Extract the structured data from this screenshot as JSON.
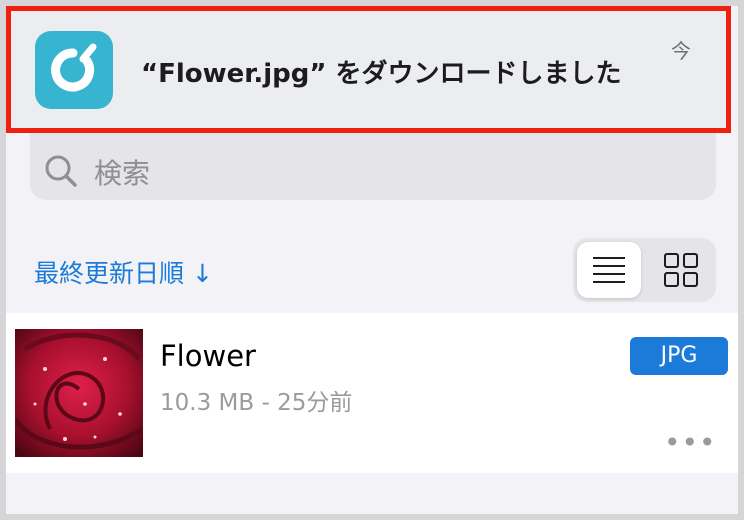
{
  "notification": {
    "message": "“Flower.jpg” をダウンロードしました",
    "time": "今",
    "app_icon": "download-app-icon",
    "highlight_color": "#ee2111"
  },
  "search": {
    "placeholder": "検索",
    "icon": "search-icon"
  },
  "sort": {
    "label": "最終更新日順 ↓"
  },
  "view_toggle": {
    "active": "list",
    "options": [
      "list",
      "grid"
    ]
  },
  "files": [
    {
      "name": "Flower",
      "meta": "10.3 MB - 25分前",
      "type": "JPG",
      "more": "•••"
    }
  ],
  "colors": {
    "accent": "#1c7bd8",
    "background": "#f2f2f7"
  }
}
